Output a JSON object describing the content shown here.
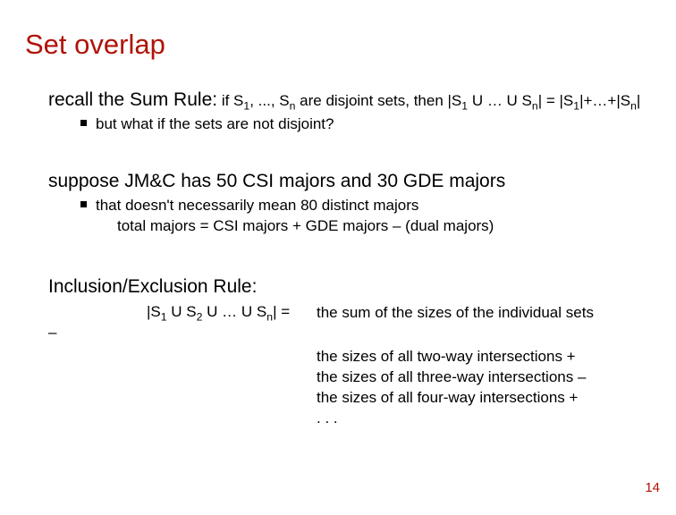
{
  "title": "Set overlap",
  "sum_rule": {
    "lead": "recall the Sum Rule:",
    "math_part1": " if S",
    "math_part2": ", ..., S",
    "math_part3": " are disjoint sets, then |S",
    "math_part4": " U … U S",
    "math_part5": "| = |S",
    "math_part6": "|+…+|S",
    "math_part7": "|",
    "sub1": "1",
    "subn": "n",
    "bullet": "but what if the sets are not disjoint?"
  },
  "example": {
    "lead": "suppose JM&C has 50 CSI majors and 30 GDE majors",
    "bullet_line1": "that doesn't necessarily mean 80 distinct majors",
    "bullet_line2": "total majors = CSI majors + GDE majors – (dual majors)"
  },
  "ie": {
    "lead": "Inclusion/Exclusion Rule:",
    "lhs_part1": "|S",
    "lhs_part2": " U S",
    "lhs_part3": " U … U S",
    "lhs_part4": "| = ",
    "sub1": "1",
    "sub2": "2",
    "subn": "n",
    "dash": "–",
    "rhs1": "the sum of the sizes of the individual sets",
    "rhs2": "the sizes of all two-way intersections +",
    "rhs3": "the sizes of all three-way intersections –",
    "rhs4": "the sizes of all four-way intersections  +",
    "rhs5": ". . ."
  },
  "slide_number": "14"
}
